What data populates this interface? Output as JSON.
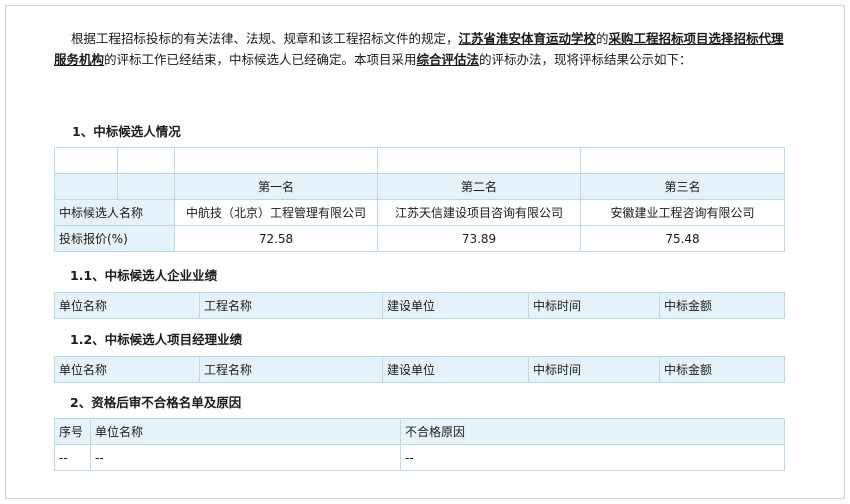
{
  "intro": {
    "p1": "根据工程招标投标的有关法律、法规、规章和该工程招标文件的规定，",
    "u1": "江苏省淮安体育运动学校",
    "p2": "的",
    "u2": "采购工程招标项目选择招标代理服务机构",
    "p3": "的评标工作已经结束，中标候选人已经确定。本项目采用",
    "u3": "综合评估法",
    "p4": "的评标办法，现将评标结果公示如下："
  },
  "section1": {
    "title": "1、中标候选人情况",
    "rank_headers": [
      "第一名",
      "第二名",
      "第三名"
    ],
    "name_label": "中标候选人名称",
    "names": [
      "中航技（北京）工程管理有限公司",
      "江苏天信建设项目咨询有限公司",
      "安徽建业工程咨询有限公司"
    ],
    "price_label": "投标报价(%)",
    "prices": [
      "72.58",
      "73.89",
      "75.48"
    ]
  },
  "section11": {
    "title": "1.1、中标候选人企业业绩",
    "headers": [
      "单位名称",
      "工程名称",
      "建设单位",
      "中标时间",
      "中标金额"
    ]
  },
  "section12": {
    "title": "1.2、中标候选人项目经理业绩",
    "headers": [
      "单位名称",
      "工程名称",
      "建设单位",
      "中标时间",
      "中标金额"
    ]
  },
  "section2": {
    "title": "2、资格后审不合格名单及原因",
    "headers": [
      "序号",
      "单位名称",
      "不合格原因"
    ],
    "row": [
      "--",
      "--",
      "--"
    ]
  }
}
